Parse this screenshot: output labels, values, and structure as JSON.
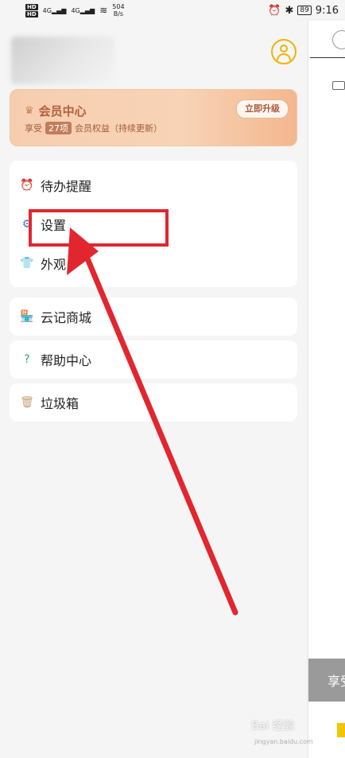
{
  "status_bar": {
    "hd1": "HD",
    "hd2": "HD",
    "signal1": "4G",
    "signal2": "4G",
    "net_speed": "504",
    "net_unit": "B/s",
    "battery": "89",
    "time": "9:16"
  },
  "member_card": {
    "title": "会员中心",
    "sub_prefix": "享受",
    "count": "27项",
    "sub_suffix": "会员权益（持续更新）",
    "upgrade_label": "立即升级"
  },
  "menu_group1": [
    {
      "label": "待办提醒",
      "icon": "alarm-clock-icon"
    },
    {
      "label": "设置",
      "icon": "gear-icon"
    },
    {
      "label": "外观",
      "icon": "shirt-icon"
    }
  ],
  "menu_shop": {
    "label": "云记商城",
    "icon": "shop-icon"
  },
  "menu_help": {
    "label": "帮助中心",
    "icon": "question-icon"
  },
  "menu_trash": {
    "label": "垃圾箱",
    "icon": "trash-icon"
  },
  "main_peek": {
    "banner_text": "享受"
  },
  "colors": {
    "accent": "#f0b400",
    "annotation": "#e2262f",
    "member_text": "#b2603a"
  },
  "watermark": {
    "brand": "Bai 经验",
    "url": "jingyan.baidu.com"
  }
}
